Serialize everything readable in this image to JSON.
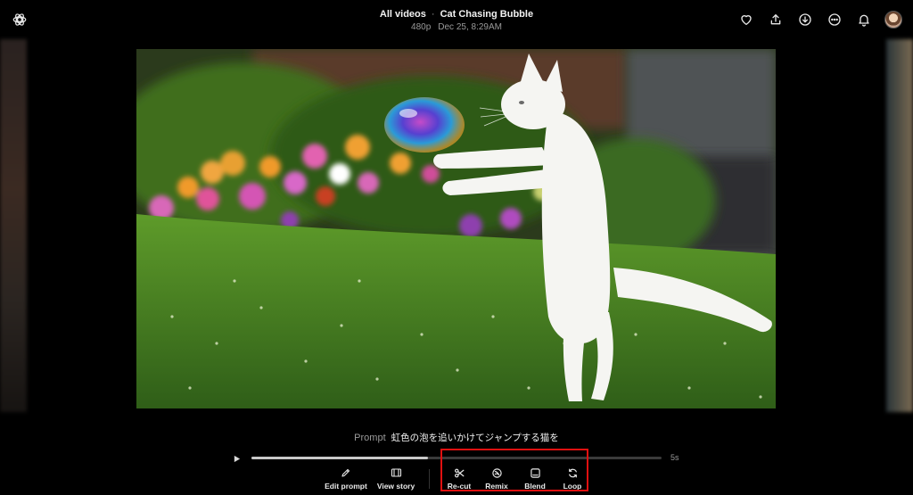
{
  "header": {
    "breadcrumb_root": "All videos",
    "breadcrumb_sep": "·",
    "title": "Cat Chasing Bubble",
    "resolution": "480p",
    "date": "Dec 25, 8:29AM",
    "icons": [
      "logo-icon",
      "heart-icon",
      "share-icon",
      "download-icon",
      "more-icon",
      "bell-icon",
      "avatar"
    ]
  },
  "prompt": {
    "label": "Prompt",
    "text": "虹色の泡を追いかけてジャンプする猫を"
  },
  "player": {
    "duration": "5s",
    "progress": 0.43
  },
  "actions": {
    "edit_prompt": "Edit prompt",
    "view_story": "View story",
    "recut": "Re-cut",
    "remix": "Remix",
    "blend": "Blend",
    "loop": "Loop"
  },
  "colors": {
    "background": "#000000",
    "highlight": "#e01010",
    "muted_text": "#9a9a9a"
  }
}
